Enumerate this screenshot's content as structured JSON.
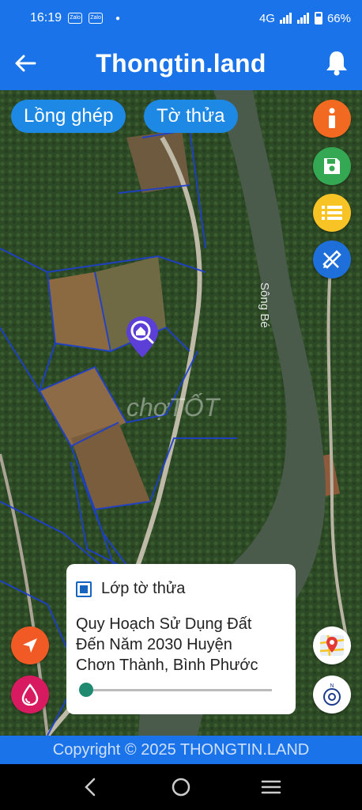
{
  "status": {
    "time": "16:19",
    "zalo1": "Zalo",
    "zalo2": "Zalo",
    "network": "4G",
    "battery": "66%"
  },
  "appbar": {
    "title": "Thongtin.land",
    "back_icon": "arrow-left-icon",
    "bell_icon": "bell-icon"
  },
  "map": {
    "chips": [
      "Lồng ghép",
      "Tờ thửa"
    ],
    "river_label": "Sông Bé",
    "watermark": "chợTỐT",
    "right_buttons": [
      {
        "icon": "info-icon",
        "color": "#f26a21"
      },
      {
        "icon": "save-icon",
        "color": "#35a853"
      },
      {
        "icon": "list-icon",
        "color": "#f7c325"
      },
      {
        "icon": "edit-ruler-icon",
        "color": "#1e6fd9"
      }
    ],
    "left_buttons": [
      {
        "icon": "navigation-arrow-icon",
        "color": "#f15a24"
      },
      {
        "icon": "water-drop-icon",
        "color": "#d81b60"
      }
    ],
    "marker_icon": "home-search-pin-icon"
  },
  "layer_card": {
    "checkbox_label": "Lớp tờ thửa",
    "description": "Quy Hoạch Sử Dụng Đất Đến Năm 2030 Huyện Chơn Thành, Bình Phước",
    "opacity": 0.0
  },
  "footer": {
    "copyright": "Copyright © 2025 THONGTIN.LAND"
  }
}
